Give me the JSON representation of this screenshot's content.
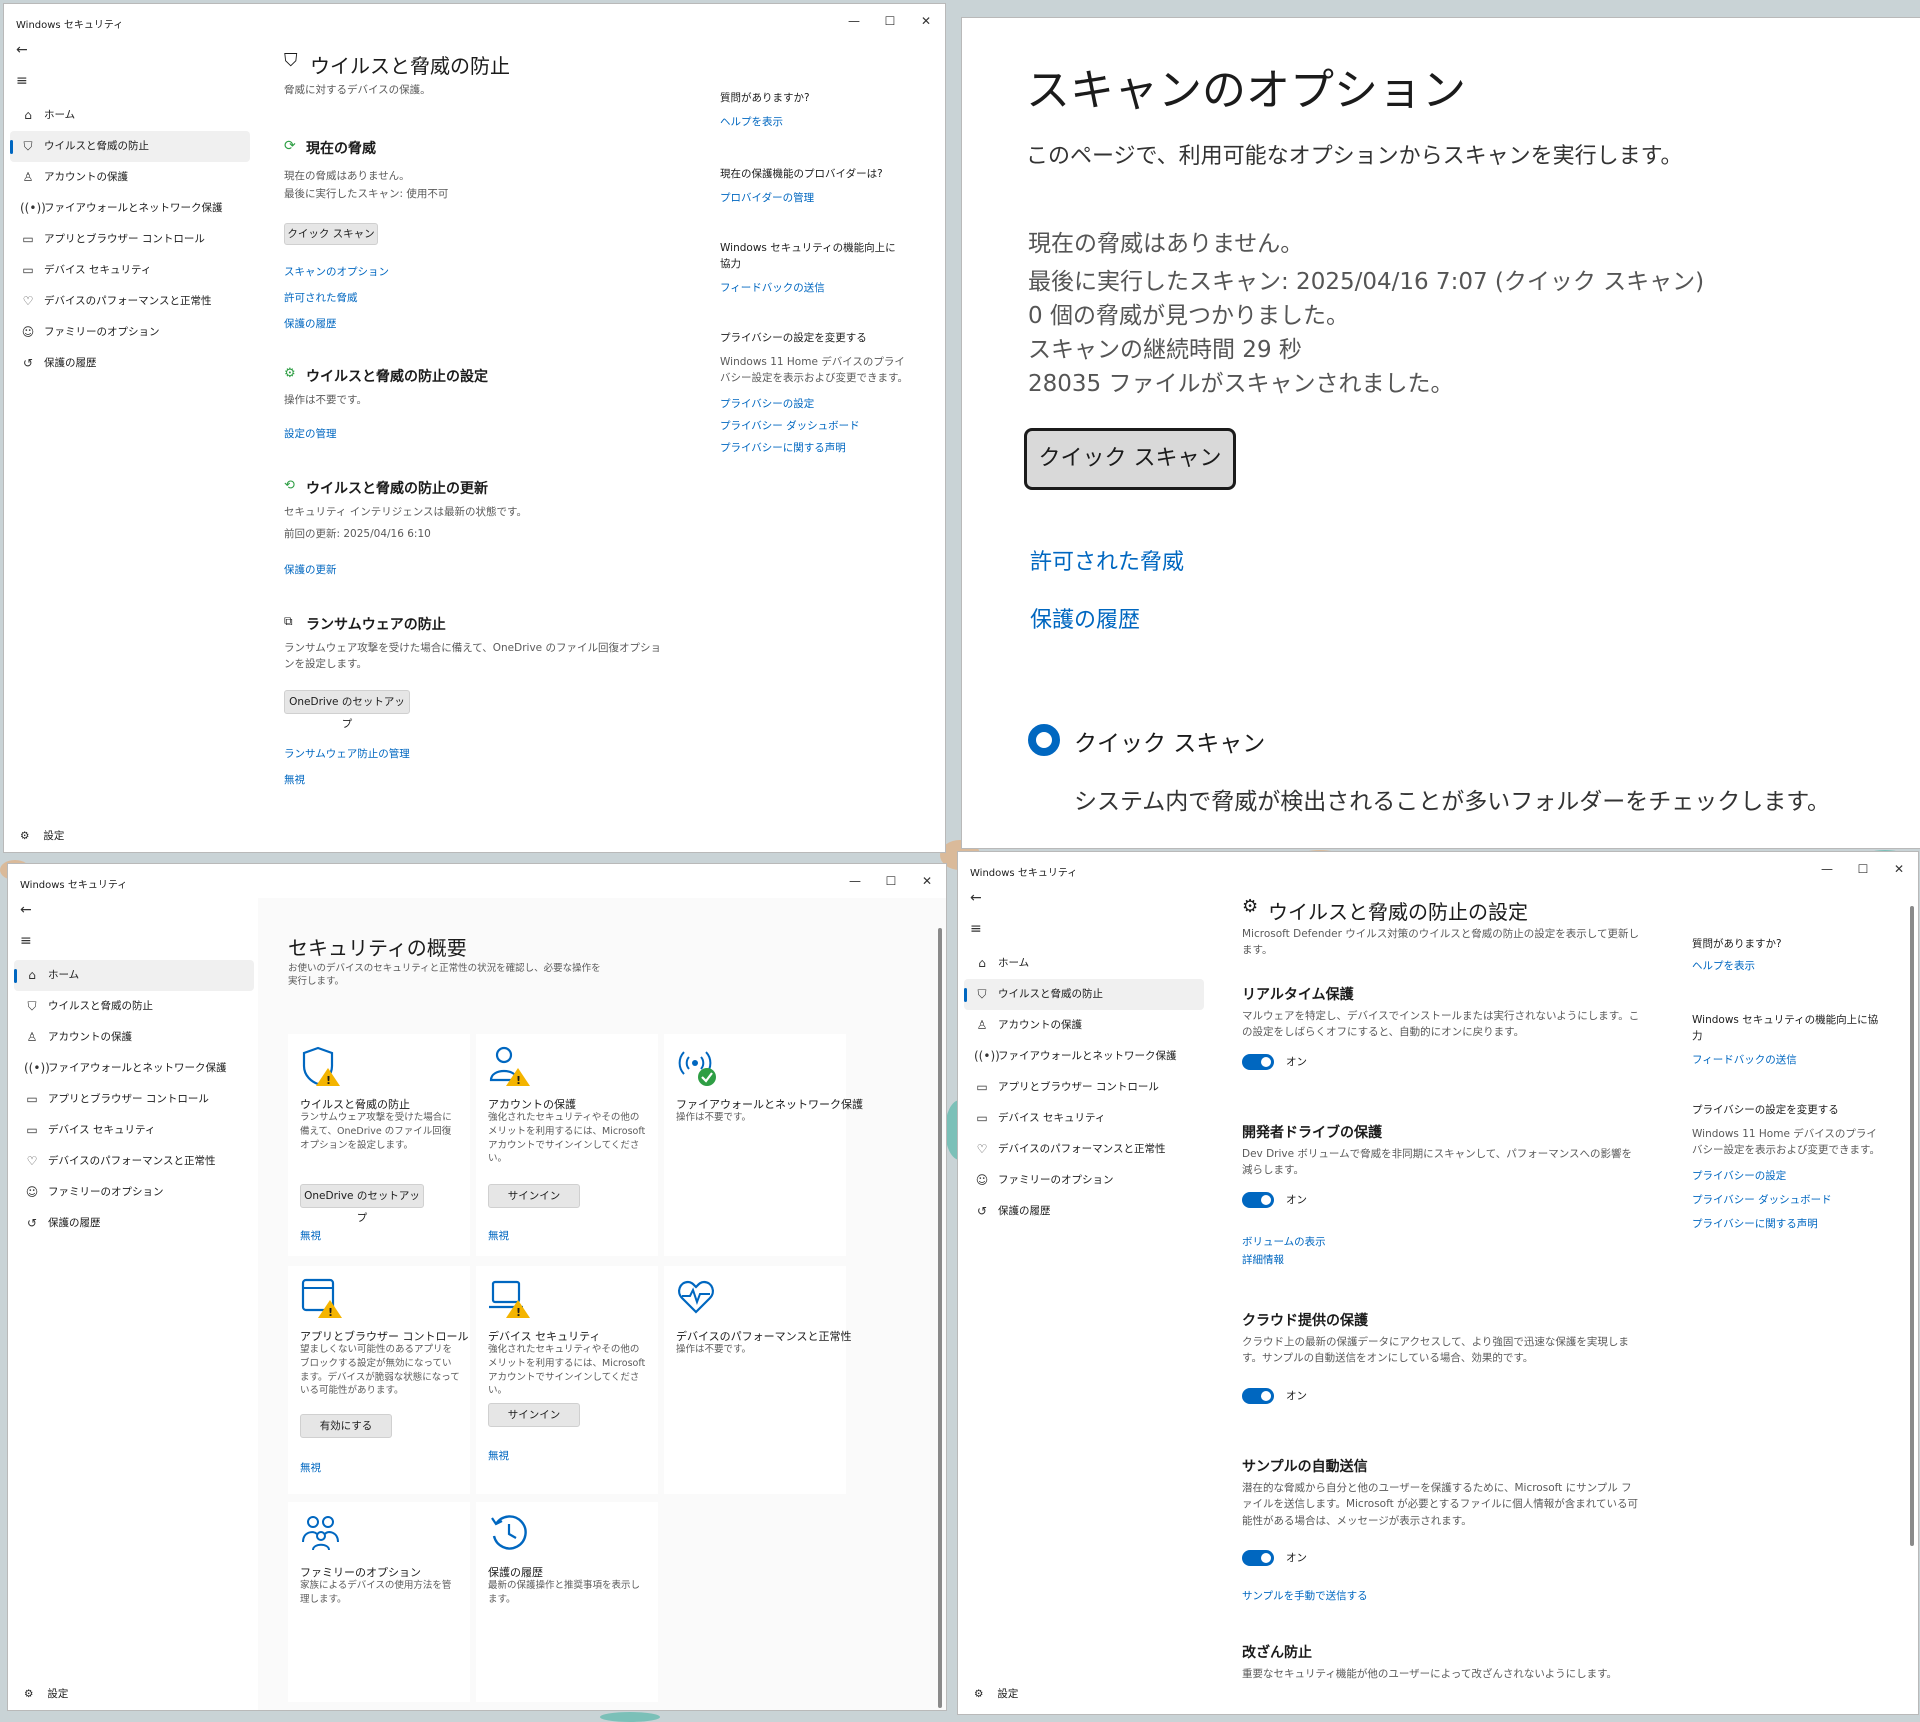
{
  "window_title": "Windows セキュリティ",
  "window_controls": {
    "minimize": "—",
    "maximize": "☐",
    "close": "✕"
  },
  "nav": {
    "back": "←",
    "menu": "≡",
    "items": [
      "ホーム",
      "ウイルスと脅威の防止",
      "アカウントの保護",
      "ファイアウォールとネットワーク保護",
      "アプリとブラウザー コントロール",
      "デバイス セキュリティ",
      "デバイスのパフォーマンスと正常性",
      "ファミリーのオプション",
      "保護の履歴"
    ],
    "settings": "設定"
  },
  "virus_page": {
    "title": "ウイルスと脅威の防止",
    "subtitle": "脅威に対するデバイスの保護。",
    "current_threats": {
      "title": "現在の脅威",
      "line1": "現在の脅威はありません。",
      "line2": "最後に実行したスキャン: 使用不可",
      "button": "クイック スキャン",
      "links": [
        "スキャンのオプション",
        "許可された脅威",
        "保護の履歴"
      ]
    },
    "settings_section": {
      "title": "ウイルスと脅威の防止の設定",
      "desc": "操作は不要です。",
      "link": "設定の管理"
    },
    "updates_section": {
      "title": "ウイルスと脅威の防止の更新",
      "line1": "セキュリティ インテリジェンスは最新の状態です。",
      "line2": "前回の更新: 2025/04/16 6:10",
      "link": "保護の更新"
    },
    "ransomware": {
      "title": "ランサムウェアの防止",
      "desc": "ランサムウェア攻撃を受けた場合に備えて、OneDrive のファイル回復オプションを設定します。",
      "button": "OneDrive のセットアップ",
      "links": [
        "ランサムウェア防止の管理",
        "無視"
      ]
    },
    "side": {
      "q": "質問がありますか?",
      "help": "ヘルプを表示",
      "provider_q": "現在の保護機能のプロバイダーは?",
      "provider_link": "プロバイダーの管理",
      "improve": "Windows セキュリティの機能向上に協力",
      "feedback": "フィードバックの送信",
      "privacy_title": "プライバシーの設定を変更する",
      "privacy_desc": "Windows 11 Home デバイスのプライバシー設定を表示および変更できます。",
      "privacy_links": [
        "プライバシーの設定",
        "プライバシー ダッシュボード",
        "プライバシーに関する声明"
      ]
    }
  },
  "scan_options": {
    "title": "スキャンのオプション",
    "subtitle": "このページで、利用可能なオプションからスキャンを実行します。",
    "lines": [
      "現在の脅威はありません。",
      "最後に実行したスキャン: 2025/04/16 7:07 (クイック スキャン)",
      "0 個の脅威が見つかりました。",
      "スキャンの継続時間 29 秒",
      "28035 ファイルがスキャンされました。"
    ],
    "button": "クイック スキャン",
    "links": [
      "許可された脅威",
      "保護の履歴"
    ],
    "option_label": "クイック スキャン",
    "option_desc": "システム内で脅威が検出されることが多いフォルダーをチェックします。"
  },
  "overview": {
    "title": "セキュリティの概要",
    "subtitle": "お使いのデバイスのセキュリティと正常性の状況を確認し、必要な操作を実行します。",
    "tiles": [
      {
        "title": "ウイルスと脅威の防止",
        "desc": "ランサムウェア攻撃を受けた場合に備えて、OneDrive のファイル回復オプションを設定します。",
        "button": "OneDrive のセットアップ",
        "link": "無視"
      },
      {
        "title": "アカウントの保護",
        "desc": "強化されたセキュリティやその他のメリットを利用するには、Microsoft アカウントでサインインしてください。",
        "button": "サインイン",
        "link": "無視"
      },
      {
        "title": "ファイアウォールとネットワーク保護",
        "desc": "操作は不要です。",
        "button": "",
        "link": ""
      },
      {
        "title": "アプリとブラウザー コントロール",
        "desc": "望ましくない可能性のあるアプリをブロックする設定が無効になっています。デバイスが脆弱な状態になっている可能性があります。",
        "button": "有効にする",
        "link": "無視"
      },
      {
        "title": "デバイス セキュリティ",
        "desc": "強化されたセキュリティやその他のメリットを利用するには、Microsoft アカウントでサインインしてください。",
        "button": "サインイン",
        "link": "無視"
      },
      {
        "title": "デバイスのパフォーマンスと正常性",
        "desc": "操作は不要です。",
        "button": "",
        "link": ""
      },
      {
        "title": "ファミリーのオプション",
        "desc": "家族によるデバイスの使用方法を管理します。",
        "button": "",
        "link": ""
      },
      {
        "title": "保護の履歴",
        "desc": "最新の保護操作と推奨事項を表示します。",
        "button": "",
        "link": ""
      }
    ]
  },
  "settings_page": {
    "title": "ウイルスと脅威の防止の設定",
    "subtitle": "Microsoft Defender ウイルス対策のウイルスと脅威の防止の設定を表示して更新します。",
    "toggle_label": "オン",
    "realtime": {
      "title": "リアルタイム保護",
      "desc": "マルウェアを特定し、デバイスでインストールまたは実行されないようにします。この設定をしばらくオフにすると、自動的にオンに戻ります。"
    },
    "devdrive": {
      "title": "開発者ドライブの保護",
      "desc": "Dev Drive ボリュームで脅威を非同期にスキャンして、パフォーマンスへの影響を減らします。",
      "links": [
        "ボリュームの表示",
        "詳細情報"
      ]
    },
    "cloud": {
      "title": "クラウド提供の保護",
      "desc": "クラウド上の最新の保護データにアクセスして、より強固で迅速な保護を実現します。サンプルの自動送信をオンにしている場合、効果的です。"
    },
    "sample": {
      "title": "サンプルの自動送信",
      "desc": "潜在的な脅威から自分と他のユーザーを保護するために、Microsoft にサンプル ファイルを送信します。Microsoft が必要とするファイルに個人情報が含まれている可能性がある場合は、メッセージが表示されます。",
      "link": "サンプルを手動で送信する"
    },
    "tamper": {
      "title": "改ざん防止",
      "desc": "重要なセキュリティ機能が他のユーザーによって改ざんされないようにします。"
    },
    "side": {
      "q": "質問がありますか?",
      "help": "ヘルプを表示",
      "improve": "Windows セキュリティの機能向上に協力",
      "feedback": "フィードバックの送信",
      "privacy_title": "プライバシーの設定を変更する",
      "privacy_desc": "Windows 11 Home デバイスのプライバシー設定を表示および変更できます。",
      "privacy_links": [
        "プライバシーの設定",
        "プライバシー ダッシュボード",
        "プライバシーに関する声明"
      ]
    }
  },
  "colors": {
    "accent": "#0067c0",
    "warning": "#f4b400",
    "ok": "#2e9e44"
  }
}
